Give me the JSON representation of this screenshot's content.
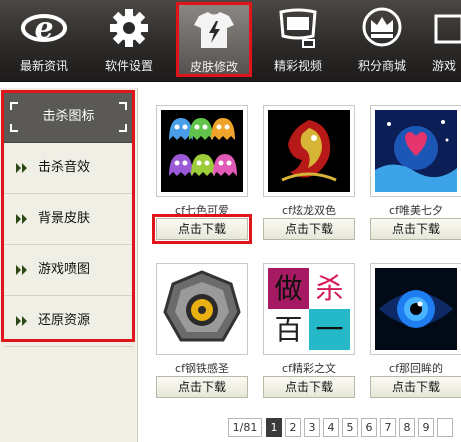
{
  "toolbar": {
    "items": [
      {
        "label": "最新资讯",
        "icon": "ie-logo-icon"
      },
      {
        "label": "软件设置",
        "icon": "gear-icon"
      },
      {
        "label": "皮肤修改",
        "icon": "shirt-icon",
        "active": true
      },
      {
        "label": "精彩视频",
        "icon": "video-icon"
      },
      {
        "label": "积分商城",
        "icon": "crown-badge-icon"
      },
      {
        "label": "游戏",
        "icon": "game-icon"
      }
    ]
  },
  "sidebar": {
    "items": [
      {
        "label": "击杀图标",
        "selected": true
      },
      {
        "label": "击杀音效"
      },
      {
        "label": "背景皮肤"
      },
      {
        "label": "游戏喷图"
      },
      {
        "label": "还原资源"
      }
    ]
  },
  "grid": {
    "download_label": "点击下载",
    "items": [
      {
        "title": "cf七色可爱"
      },
      {
        "title": "cf炫龙双色"
      },
      {
        "title": "cf唯美七夕"
      },
      {
        "title": "cf钢铁感圣"
      },
      {
        "title": "cf精彩之文"
      },
      {
        "title": "cf那回眸的"
      }
    ],
    "thumb_text": {
      "zh1": "做",
      "zh2": "杀",
      "zh3": "百",
      "zh4": "一"
    }
  },
  "pager": {
    "total": "1/81",
    "current": "1",
    "pages": [
      "2",
      "3",
      "4",
      "5",
      "6",
      "7",
      "8",
      "9"
    ]
  },
  "colors": {
    "highlight": "#e0141a",
    "toolbar_bg": "#2b2927",
    "sidebar_bg": "#efefe6"
  }
}
